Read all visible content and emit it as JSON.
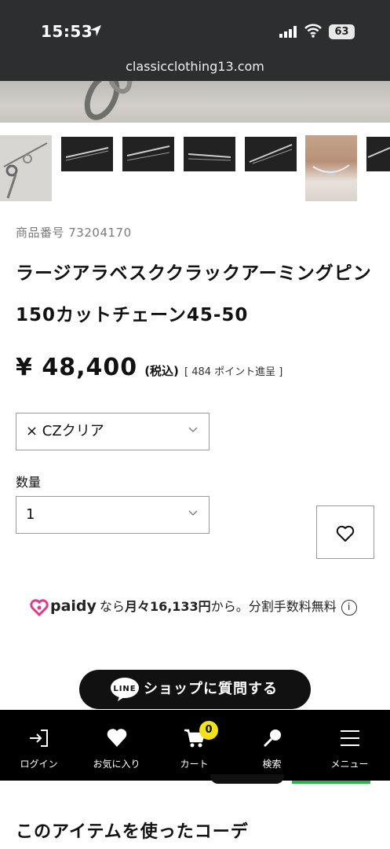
{
  "status": {
    "time": "15:53",
    "battery": "63"
  },
  "browser": {
    "url": "classicclothing13.com"
  },
  "product": {
    "sku_label": "商品番号 73204170",
    "name": "ラージアラベスククラックアーミングピン150カットチェーン45-50",
    "price": "¥ 48,400",
    "tax_label": "(税込)",
    "points": "[ 484 ポイント進呈 ]"
  },
  "variant": {
    "selected": "× CZクリア"
  },
  "quantity": {
    "label": "数量",
    "selected": "1"
  },
  "paidy": {
    "logo_text": "paidy",
    "text_pre": "なら",
    "text_amount": "月々16,133円",
    "text_post": "から。分割手数料無料"
  },
  "line_button": {
    "badge": "LINE",
    "label": "ショップに質問する"
  },
  "bottom_nav": {
    "items": [
      {
        "label": "ログイン",
        "icon": "login-icon"
      },
      {
        "label": "お気に入り",
        "icon": "heart-icon"
      },
      {
        "label": "カート",
        "icon": "cart-icon"
      },
      {
        "label": "検索",
        "icon": "search-icon"
      },
      {
        "label": "メニュー",
        "icon": "menu-icon"
      }
    ],
    "cart_count": "0"
  },
  "coordinate_section": {
    "title": "このアイテムを使ったコーデ"
  },
  "colors": {
    "topbar": "#2c2e30",
    "nav": "#000000",
    "cart_badge": "#f2e21b",
    "paidy_pink": "#e4388a"
  }
}
